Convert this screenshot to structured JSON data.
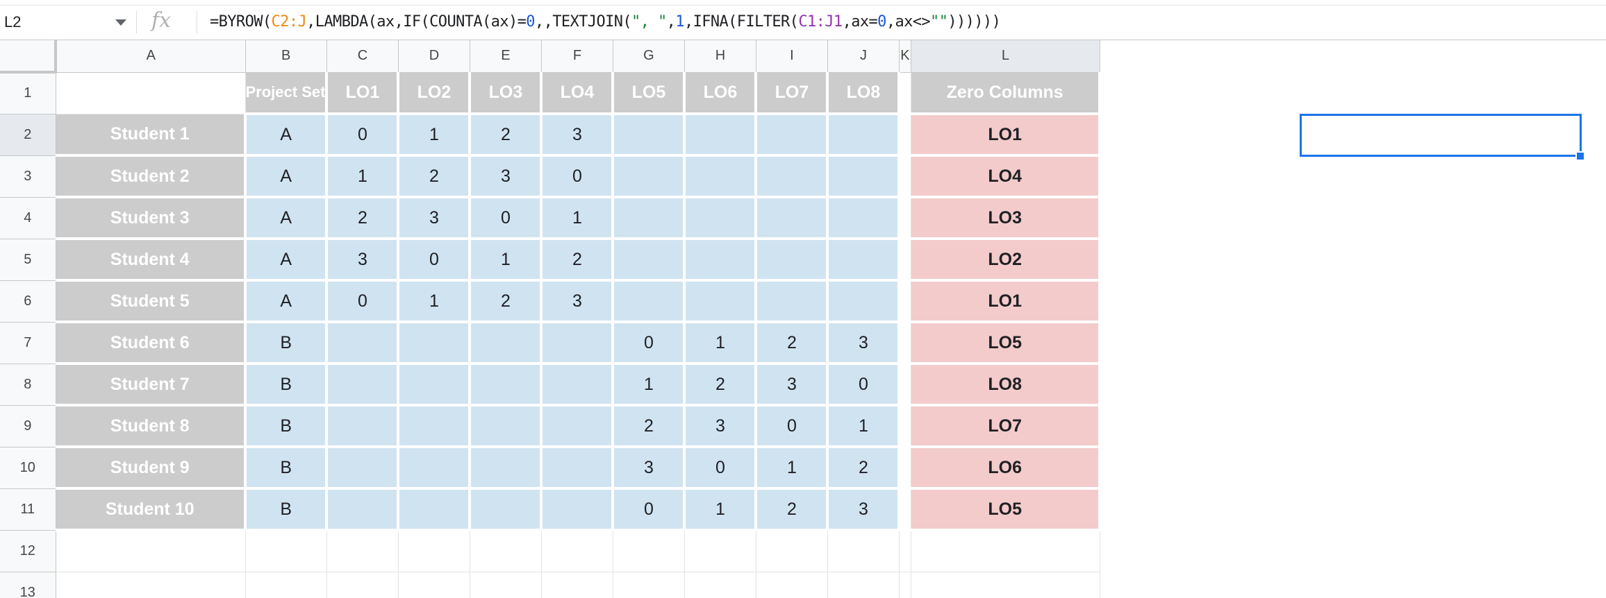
{
  "name_box": "L2",
  "formula_bar": {
    "fx_icon": "fx",
    "tokens": [
      {
        "t": "=BYROW(",
        "c": ""
      },
      {
        "t": "C2:J",
        "c": "tok-r1"
      },
      {
        "t": ",LAMBDA(ax,IF(COUNTA(ax)=",
        "c": ""
      },
      {
        "t": "0",
        "c": "tok-num"
      },
      {
        "t": ",,TEXTJOIN(",
        "c": ""
      },
      {
        "t": "\", \"",
        "c": "tok-str"
      },
      {
        "t": ",",
        "c": ""
      },
      {
        "t": "1",
        "c": "tok-num"
      },
      {
        "t": ",IFNA(FILTER(",
        "c": ""
      },
      {
        "t": "C1:J1",
        "c": "tok-r2"
      },
      {
        "t": ",ax=",
        "c": ""
      },
      {
        "t": "0",
        "c": "tok-num"
      },
      {
        "t": ",ax<>",
        "c": ""
      },
      {
        "t": "\"\"",
        "c": "tok-str"
      },
      {
        "t": "))))))",
        "c": ""
      }
    ]
  },
  "columns": [
    "A",
    "B",
    "C",
    "D",
    "E",
    "F",
    "G",
    "H",
    "I",
    "J",
    "K",
    "L"
  ],
  "selected_column": "L",
  "row_numbers": [
    "1",
    "2",
    "3",
    "4",
    "5",
    "6",
    "7",
    "8",
    "9",
    "10",
    "11",
    "12",
    "13"
  ],
  "selected_row": "2",
  "header_row": [
    "",
    "Project Set",
    "LO1",
    "LO2",
    "LO3",
    "LO4",
    "LO5",
    "LO6",
    "LO7",
    "LO8",
    "",
    "Zero Columns"
  ],
  "rows": [
    {
      "student": "Student 1",
      "set": "A",
      "scores": [
        "0",
        "1",
        "2",
        "3",
        "",
        "",
        "",
        ""
      ],
      "zero": "LO1"
    },
    {
      "student": "Student 2",
      "set": "A",
      "scores": [
        "1",
        "2",
        "3",
        "0",
        "",
        "",
        "",
        ""
      ],
      "zero": "LO4"
    },
    {
      "student": "Student 3",
      "set": "A",
      "scores": [
        "2",
        "3",
        "0",
        "1",
        "",
        "",
        "",
        ""
      ],
      "zero": "LO3"
    },
    {
      "student": "Student 4",
      "set": "A",
      "scores": [
        "3",
        "0",
        "1",
        "2",
        "",
        "",
        "",
        ""
      ],
      "zero": "LO2"
    },
    {
      "student": "Student 5",
      "set": "A",
      "scores": [
        "0",
        "1",
        "2",
        "3",
        "",
        "",
        "",
        ""
      ],
      "zero": "LO1"
    },
    {
      "student": "Student 6",
      "set": "B",
      "scores": [
        "",
        "",
        "",
        "",
        "0",
        "1",
        "2",
        "3"
      ],
      "zero": "LO5"
    },
    {
      "student": "Student 7",
      "set": "B",
      "scores": [
        "",
        "",
        "",
        "",
        "1",
        "2",
        "3",
        "0"
      ],
      "zero": "LO8"
    },
    {
      "student": "Student 8",
      "set": "B",
      "scores": [
        "",
        "",
        "",
        "",
        "2",
        "3",
        "0",
        "1"
      ],
      "zero": "LO7"
    },
    {
      "student": "Student 9",
      "set": "B",
      "scores": [
        "",
        "",
        "",
        "",
        "3",
        "0",
        "1",
        "2"
      ],
      "zero": "LO6"
    },
    {
      "student": "Student 10",
      "set": "B",
      "scores": [
        "",
        "",
        "",
        "",
        "0",
        "1",
        "2",
        "3"
      ],
      "zero": "LO5"
    }
  ],
  "colors": {
    "header_gray": "#cccccc",
    "data_blue": "#d0e3f1",
    "result_pink": "#f3cbcb",
    "selection_blue": "#1a73e8"
  }
}
